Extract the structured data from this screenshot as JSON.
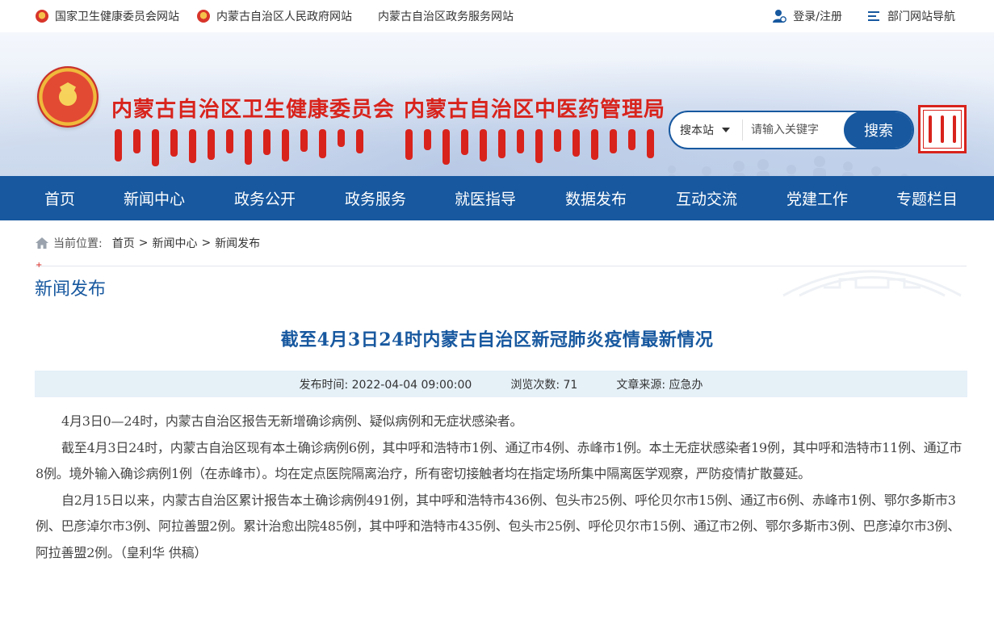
{
  "topbar": {
    "links": [
      "国家卫生健康委员会网站",
      "内蒙古自治区人民政府网站",
      "内蒙古自治区政务服务网站"
    ],
    "login": "登录/注册",
    "dept_nav": "部门网站导航"
  },
  "banner": {
    "title1": "内蒙古自治区卫生健康委员会",
    "title2": "内蒙古自治区中医药管理局"
  },
  "search": {
    "scope": "搜本站",
    "placeholder": "请输入关键字",
    "button": "搜索"
  },
  "nav": [
    "首页",
    "新闻中心",
    "政务公开",
    "政务服务",
    "就医指导",
    "数据发布",
    "互动交流",
    "党建工作",
    "专题栏目"
  ],
  "breadcrumb": {
    "label": "当前位置:",
    "items": [
      "首页",
      "新闻中心",
      "新闻发布"
    ]
  },
  "section": {
    "plus": "+",
    "title": "新闻发布"
  },
  "article": {
    "title": "截至4月3日24时内蒙古自治区新冠肺炎疫情最新情况",
    "publish_time": "发布时间:  2022-04-04 09:00:00",
    "views": "浏览次数:  71",
    "source": "文章来源:  应急办",
    "paragraphs": [
      "4月3日0—24时，内蒙古自治区报告无新增确诊病例、疑似病例和无症状感染者。",
      "截至4月3日24时，内蒙古自治区现有本土确诊病例6例，其中呼和浩特市1例、通辽市4例、赤峰市1例。本土无症状感染者19例，其中呼和浩特市11例、通辽市8例。境外输入确诊病例1例（在赤峰市）。均在定点医院隔离治疗，所有密切接触者均在指定场所集中隔离医学观察，严防疫情扩散蔓延。",
      "自2月15日以来，内蒙古自治区累计报告本土确诊病例491例，其中呼和浩特市436例、包头市25例、呼伦贝尔市15例、通辽市6例、赤峰市1例、鄂尔多斯市3例、巴彦淖尔市3例、阿拉善盟2例。累计治愈出院485例，其中呼和浩特市435例、包头市25例、呼伦贝尔市15例、通辽市2例、鄂尔多斯市3例、巴彦淖尔市3例、阿拉善盟2例。（皇利华 供稿）"
    ]
  },
  "colors": {
    "primary": "#17589f",
    "brand_red": "#d8231c",
    "meta_bg": "#e5f0f7"
  }
}
